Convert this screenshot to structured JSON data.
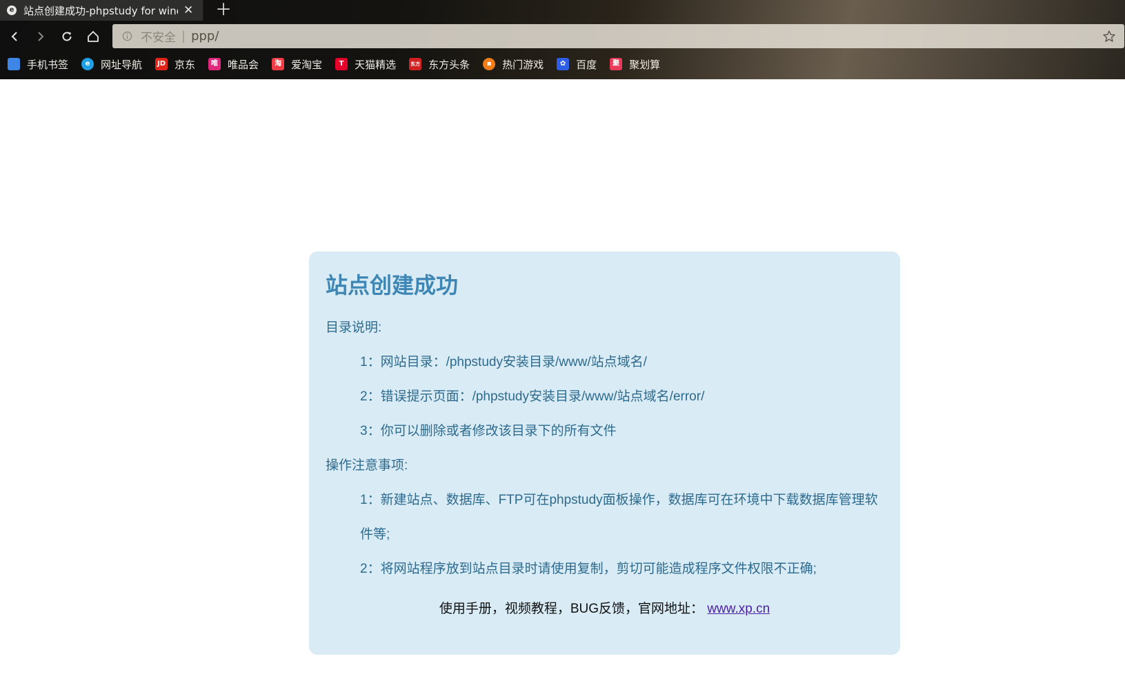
{
  "browser": {
    "tab": {
      "favicon": "e",
      "title": "站点创建成功-phpstudy for windows"
    },
    "nav": {
      "back": "back-arrow-icon",
      "forward": "forward-arrow-icon",
      "reload": "reload-icon",
      "home": "home-icon"
    },
    "address": {
      "security": "不安全",
      "url": "ppp/"
    },
    "bookmarks": [
      {
        "label": "手机书签",
        "icon_text": "",
        "color": "#3d86e6"
      },
      {
        "label": "网址导航",
        "icon_text": "e",
        "color": "#1fa0e6"
      },
      {
        "label": "京东",
        "icon_text": "JD",
        "color": "#e1251b"
      },
      {
        "label": "唯品会",
        "icon_text": "唯",
        "color": "#e0287f"
      },
      {
        "label": "爱淘宝",
        "icon_text": "淘",
        "color": "#f23c45"
      },
      {
        "label": "天猫精选",
        "icon_text": "T",
        "color": "#e4002b"
      },
      {
        "label": "东方头条",
        "icon_text": "东方",
        "color": "#d21f1f"
      },
      {
        "label": "热门游戏",
        "icon_text": "▪",
        "color": "#ef7d1a"
      },
      {
        "label": "百度",
        "icon_text": "✿",
        "color": "#2e5de6"
      },
      {
        "label": "聚划算",
        "icon_text": "聚",
        "color": "#ea3a5a"
      }
    ]
  },
  "page": {
    "title": "站点创建成功",
    "dir_heading": "目录说明:",
    "dir_items": [
      "1：网站目录：/phpstudy安装目录/www/站点域名/",
      "2：错误提示页面：/phpstudy安装目录/www/站点域名/error/",
      "3：你可以删除或者修改该目录下的所有文件"
    ],
    "ops_heading": "操作注意事项:",
    "ops_items": [
      "1：新建站点、数据库、FTP可在phpstudy面板操作，数据库可在环境中下载数据库管理软件等;",
      "2：将网站程序放到站点目录时请使用复制，剪切可能造成程序文件权限不正确;"
    ],
    "footer_text": "使用手册，视频教程，BUG反馈，官网地址：",
    "footer_link": "www.xp.cn"
  }
}
